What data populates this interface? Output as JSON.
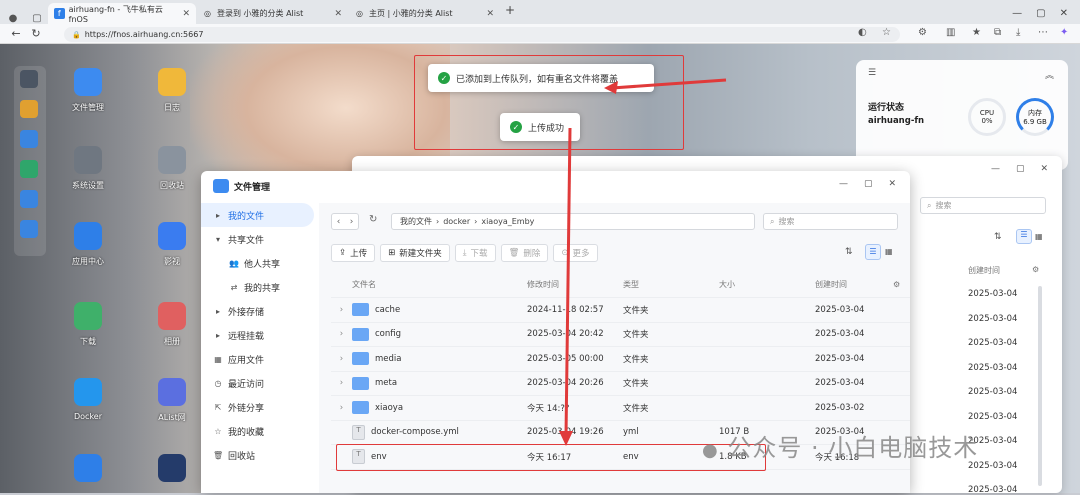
{
  "tabs": [
    {
      "label": "airhuang-fn - 飞牛私有云fnOS",
      "active": true
    },
    {
      "label": "登录到 小雅的分类 Alist",
      "active": false
    },
    {
      "label": "主页 | 小雅的分类 Alist",
      "active": false
    }
  ],
  "url": "https://fnos.airhuang.cn:5667",
  "desktop_icons": [
    {
      "label": "文件管理",
      "color": "#3d8bf0"
    },
    {
      "label": "日志",
      "color": "#f0b83a"
    },
    {
      "label": "系统设置",
      "color": "#6f7781"
    },
    {
      "label": "回收站",
      "color": "#8a939e"
    },
    {
      "label": "应用中心",
      "color": "#2e7fe8"
    },
    {
      "label": "影视",
      "color": "#3a7cf0"
    },
    {
      "label": "下载",
      "color": "#3fb06a"
    },
    {
      "label": "相册",
      "color": "#e06060"
    },
    {
      "label": "Docker",
      "color": "#2496ed"
    },
    {
      "label": "AList网",
      "color": "#5b6fe0"
    }
  ],
  "toasts": {
    "queued": "已添加到上传队列，如有重名文件将覆盖",
    "success": "上传成功"
  },
  "widget": {
    "title": "运行状态",
    "host": "airhuang-fn",
    "cpu_label": "CPU",
    "cpu_value": "0%",
    "mem_label": "内存",
    "mem_value": "6.9 GB"
  },
  "back_window": {
    "search_placeholder": "搜索",
    "col_created": "创建时间",
    "dates": [
      "2025-03-04",
      "2025-03-04",
      "2025-03-04",
      "2025-03-04",
      "2025-03-04",
      "2025-03-04",
      "2025-03-04",
      "2025-03-04",
      "2025-03-04"
    ]
  },
  "window": {
    "title": "文件管理"
  },
  "sidebar": [
    {
      "label": "我的文件",
      "icon": "▸",
      "active": true,
      "indent": 0
    },
    {
      "label": "共享文件",
      "icon": "▾",
      "active": false,
      "indent": 0
    },
    {
      "label": "他人共享",
      "icon": "👥",
      "active": false,
      "indent": 1
    },
    {
      "label": "我的共享",
      "icon": "⇄",
      "active": false,
      "indent": 1
    },
    {
      "label": "外接存储",
      "icon": "▸",
      "active": false,
      "indent": 0
    },
    {
      "label": "远程挂载",
      "icon": "▸",
      "active": false,
      "indent": 0
    },
    {
      "label": "应用文件",
      "icon": "▦",
      "active": false,
      "indent": 0
    },
    {
      "label": "最近访问",
      "icon": "◷",
      "active": false,
      "indent": 0
    },
    {
      "label": "外链分享",
      "icon": "⇱",
      "active": false,
      "indent": 0
    },
    {
      "label": "我的收藏",
      "icon": "☆",
      "active": false,
      "indent": 0
    },
    {
      "label": "回收站",
      "icon": "🗑",
      "active": false,
      "indent": 0
    }
  ],
  "breadcrumb": [
    "我的文件",
    "docker",
    "xiaoya_Emby"
  ],
  "search_placeholder": "搜索",
  "toolbar": {
    "upload": "上传",
    "new_folder": "新建文件夹",
    "download": "下载",
    "delete": "删除",
    "more": "更多"
  },
  "columns": {
    "name": "文件名",
    "modified": "修改时间",
    "type": "类型",
    "size": "大小",
    "created": "创建时间"
  },
  "files": [
    {
      "name": "cache",
      "modified": "2024-11-18 02:57",
      "type": "文件夹",
      "size": "",
      "created": "2025-03-04",
      "kind": "folder"
    },
    {
      "name": "config",
      "modified": "2025-03-04 20:42",
      "type": "文件夹",
      "size": "",
      "created": "2025-03-04",
      "kind": "folder"
    },
    {
      "name": "media",
      "modified": "2025-03-05 00:00",
      "type": "文件夹",
      "size": "",
      "created": "2025-03-04",
      "kind": "folder"
    },
    {
      "name": "meta",
      "modified": "2025-03-04 20:26",
      "type": "文件夹",
      "size": "",
      "created": "2025-03-04",
      "kind": "folder"
    },
    {
      "name": "xiaoya",
      "modified": "今天 14:??",
      "type": "文件夹",
      "size": "",
      "created": "2025-03-02",
      "kind": "folder"
    },
    {
      "name": "docker-compose.yml",
      "modified": "2025-03-04 19:26",
      "type": "yml",
      "size": "1017 B",
      "created": "2025-03-04",
      "kind": "file"
    },
    {
      "name": "env",
      "modified": "今天 16:17",
      "type": "env",
      "size": "1.8 KB",
      "created": "今天 16:18",
      "kind": "file"
    }
  ],
  "watermark": "公众号 · 小白电脑技术"
}
